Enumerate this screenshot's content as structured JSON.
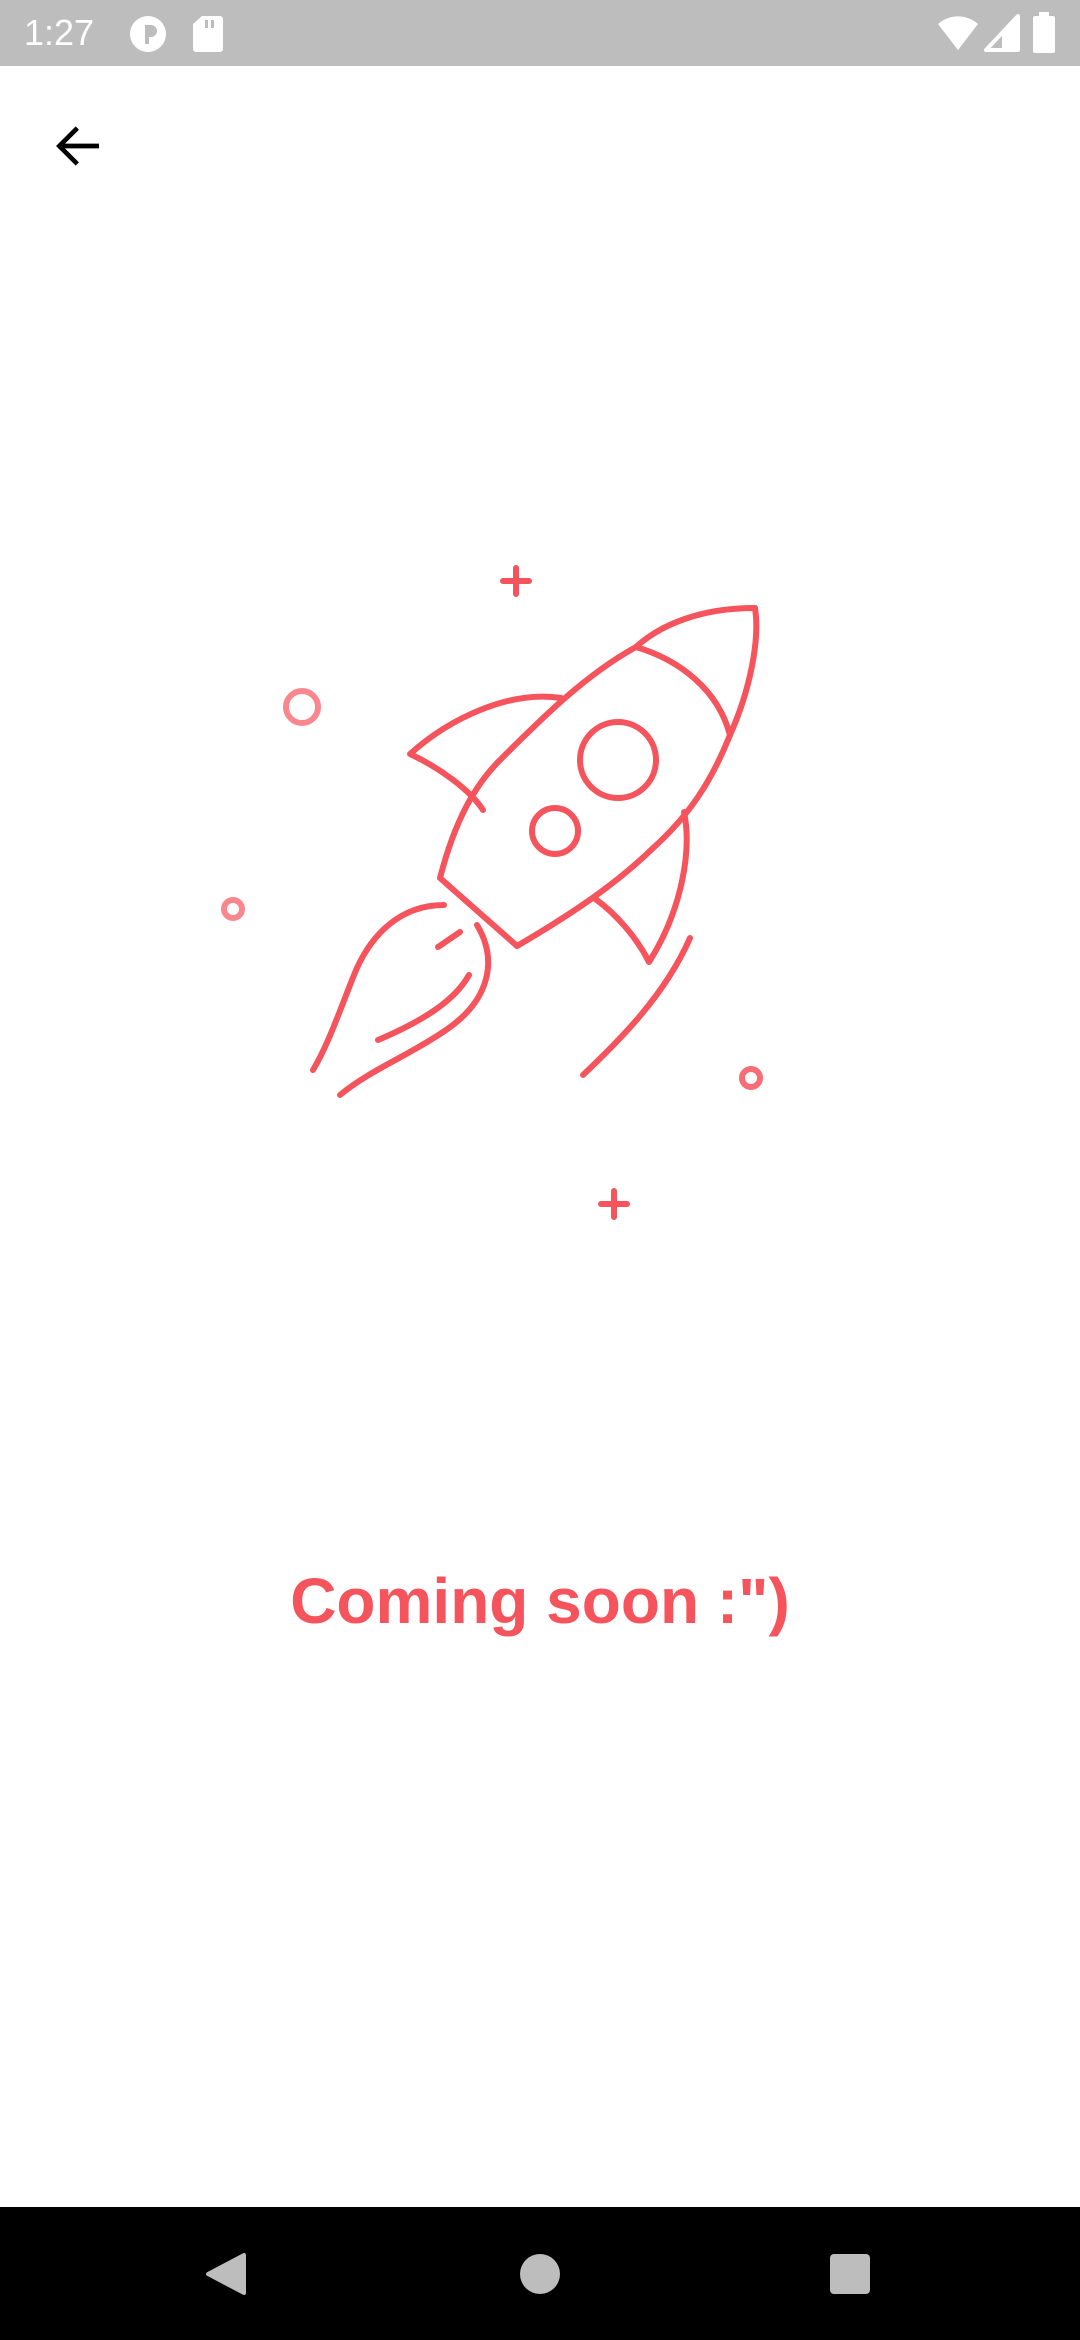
{
  "status_bar": {
    "time": "1:27",
    "icons": [
      "notification-badge-icon",
      "sd-card-icon",
      "wifi-icon",
      "cell-signal-icon",
      "battery-icon"
    ]
  },
  "toolbar": {
    "back_icon": "arrow-back-icon"
  },
  "illustration": {
    "icon": "rocket-illustration",
    "color": "#F6545D"
  },
  "main": {
    "message": "Coming soon :\")",
    "accent_color": "#F6545D"
  },
  "nav_bar": {
    "buttons": [
      "back-triangle-icon",
      "home-circle-icon",
      "recents-square-icon"
    ],
    "icon_color": "#bdbdbd"
  }
}
